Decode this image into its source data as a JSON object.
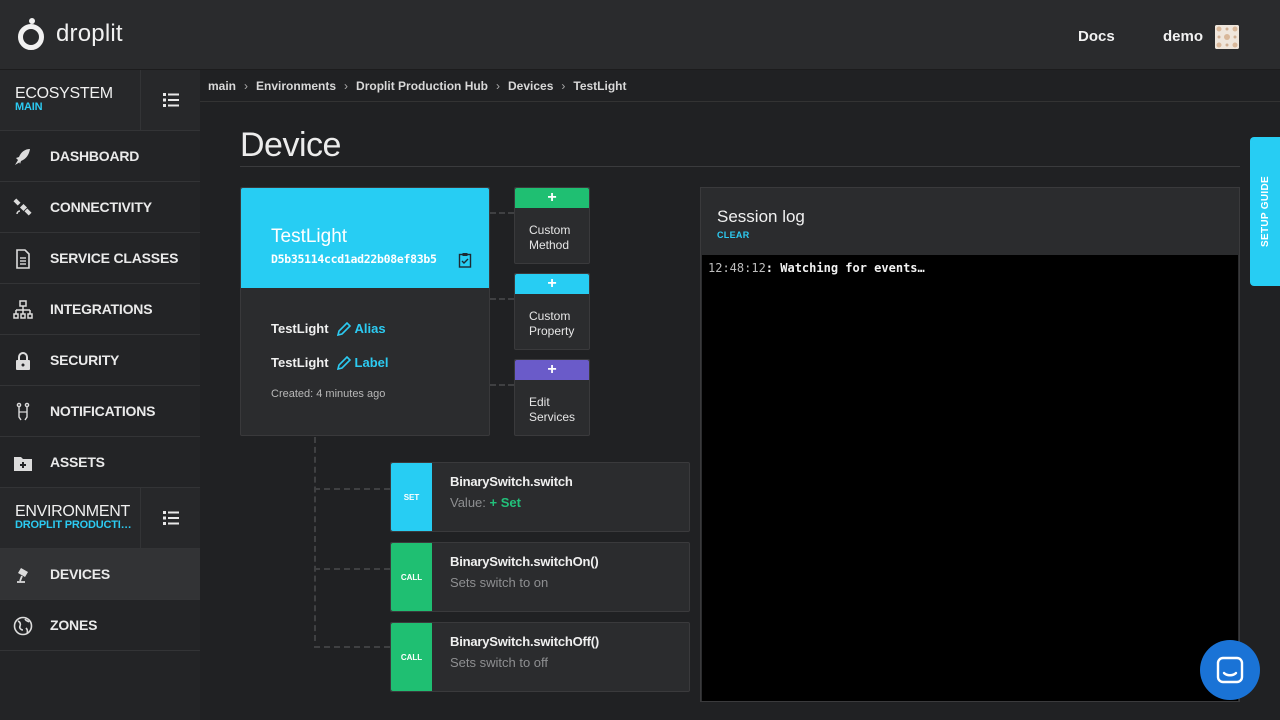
{
  "header": {
    "logo_text": "droplit",
    "docs_label": "Docs",
    "user_label": "demo"
  },
  "sidebar": {
    "ecosystem": {
      "title": "ECOSYSTEM",
      "subtitle": "MAIN"
    },
    "ecosystem_items": [
      {
        "label": "DASHBOARD",
        "icon": "rocket-icon"
      },
      {
        "label": "CONNECTIVITY",
        "icon": "satellite-icon"
      },
      {
        "label": "SERVICE CLASSES",
        "icon": "document-icon"
      },
      {
        "label": "INTEGRATIONS",
        "icon": "sitemap-icon"
      },
      {
        "label": "SECURITY",
        "icon": "lock-icon"
      },
      {
        "label": "NOTIFICATIONS",
        "icon": "notification-icon"
      },
      {
        "label": "ASSETS",
        "icon": "folder-plus-icon"
      }
    ],
    "environment": {
      "title": "ENVIRONMENT",
      "subtitle": "DROPLIT PRODUCTIO..."
    },
    "environment_items": [
      {
        "label": "DEVICES",
        "icon": "lamp-icon",
        "active": true
      },
      {
        "label": "ZONES",
        "icon": "globe-icon"
      }
    ]
  },
  "breadcrumb": [
    "main",
    "Environments",
    "Droplit Production Hub",
    "Devices",
    "TestLight"
  ],
  "page": {
    "title": "Device"
  },
  "device": {
    "name": "TestLight",
    "id": "D5b35114ccd1ad22b08ef83b5",
    "alias_value": "TestLight",
    "alias_action": "Alias",
    "label_value": "TestLight",
    "label_action": "Label",
    "created": "Created: 4 minutes ago"
  },
  "tiles": [
    {
      "symbol": "+",
      "line1": "Custom",
      "line2": "Method",
      "color": "#1fbf72"
    },
    {
      "symbol": "+",
      "line1": "Custom",
      "line2": "Property",
      "color": "#27cdf3"
    },
    {
      "symbol": "+",
      "line1": "Edit",
      "line2": "Services",
      "color": "#6a5bc9"
    }
  ],
  "services": [
    {
      "badge": "SET",
      "badge_color": "#27cdf3",
      "name": "BinarySwitch.switch",
      "desc_prefix": "Value:",
      "desc_action": "+ Set"
    },
    {
      "badge": "CALL",
      "badge_color": "#1fbf72",
      "name": "BinarySwitch.switchOn()",
      "desc": "Sets switch to on"
    },
    {
      "badge": "CALL",
      "badge_color": "#1fbf72",
      "name": "BinarySwitch.switchOff()",
      "desc": "Sets switch to off"
    }
  ],
  "session_log": {
    "title": "Session log",
    "clear_label": "CLEAR",
    "lines": [
      {
        "time": "12:48:12",
        "text": ": Watching for events…"
      }
    ]
  },
  "setup_guide": {
    "label": "SETUP GUIDE"
  },
  "colors": {
    "accent": "#27cdf3",
    "green": "#1fbf72",
    "purple": "#6a5bc9",
    "chat": "#1a73d6"
  }
}
